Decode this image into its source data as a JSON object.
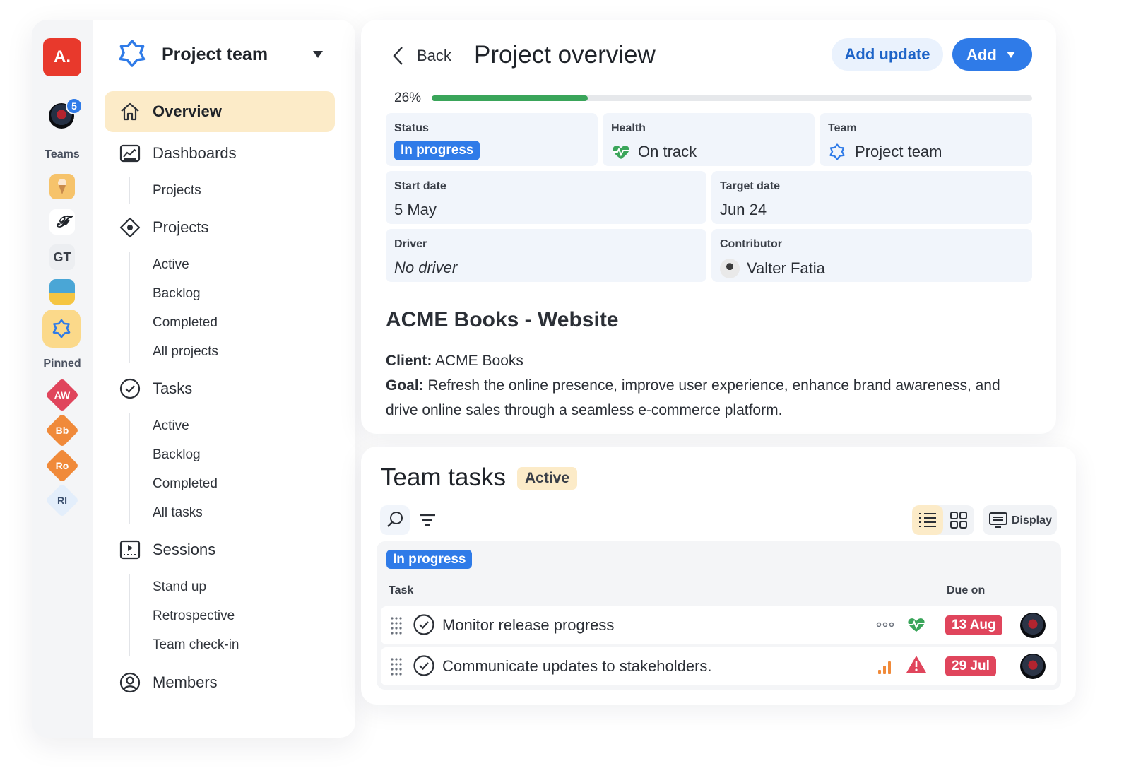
{
  "rail": {
    "logo": "A.",
    "notification_count": "5",
    "teams_label": "Teams",
    "teams": [
      {
        "icon": "ice-cream-icon",
        "bg": "#f6c36b"
      },
      {
        "icon": "f-script-icon",
        "text": "𝓕"
      },
      {
        "icon": "gt-initials",
        "text": "GT"
      },
      {
        "icon": "beach-icon",
        "bg": "#4aa6d6"
      },
      {
        "icon": "star-badge-icon",
        "bg": "#fbd98a"
      }
    ],
    "pinned_label": "Pinned",
    "pinned": [
      {
        "text": "AW",
        "color": "#e0455c"
      },
      {
        "text": "Bb",
        "color": "#f08a3a"
      },
      {
        "text": "Ro",
        "color": "#f08a3a"
      },
      {
        "text": "RI",
        "color": "#e3eefb"
      }
    ]
  },
  "nav": {
    "team_name": "Project team",
    "items": [
      {
        "label": "Overview",
        "icon": "home-icon",
        "active": true
      },
      {
        "label": "Dashboards",
        "icon": "dashboard-icon"
      },
      {
        "label": "Projects",
        "icon": "diamond-icon"
      },
      {
        "label": "Tasks",
        "icon": "check-circle-icon"
      },
      {
        "label": "Sessions",
        "icon": "play-board-icon"
      },
      {
        "label": "Members",
        "icon": "user-circle-icon"
      }
    ],
    "dashboards_sub": [
      "Projects"
    ],
    "projects_sub": [
      "Active",
      "Backlog",
      "Completed",
      "All projects"
    ],
    "tasks_sub": [
      "Active",
      "Backlog",
      "Completed",
      "All tasks"
    ],
    "sessions_sub": [
      "Stand up",
      "Retrospective",
      "Team check-in"
    ]
  },
  "overview": {
    "back_label": "Back",
    "title": "Project overview",
    "add_update_label": "Add update",
    "add_label": "Add",
    "progress_percent": 26,
    "progress_label": "26%",
    "progress_color": "#3aa55a",
    "fields": {
      "status_key": "Status",
      "status_value": "In progress",
      "health_key": "Health",
      "health_value": "On track",
      "team_key": "Team",
      "team_value": "Project team",
      "start_key": "Start date",
      "start_value": "5 May",
      "target_key": "Target date",
      "target_value": "Jun 24",
      "driver_key": "Driver",
      "driver_value": "No driver",
      "contributor_key": "Contributor",
      "contributor_value": "Valter Fatia"
    },
    "project_name": "ACME Books - Website",
    "client_key": "Client:",
    "client_value": " ACME Books",
    "goal_key": "Goal:",
    "goal_line1": " Refresh the online presence, improve user experience, enhance brand awareness, and",
    "goal_line2": "drive online sales through a seamless e-commerce platform."
  },
  "tasks": {
    "title": "Team tasks",
    "filter_chip": "Active",
    "display_label": "Display",
    "group_label": "In progress",
    "col_task": "Task",
    "col_due": "Due on",
    "rows": [
      {
        "name": "Monitor release progress",
        "due": "13 Aug",
        "indicator": "more-dots-icon",
        "status_icon": "heart-pulse-icon"
      },
      {
        "name": "Communicate updates to stakeholders.",
        "due": "29 Jul",
        "indicator": "priority-bars-icon",
        "status_icon": "warning-triangle-icon"
      }
    ],
    "due_color": "#e0455c"
  }
}
